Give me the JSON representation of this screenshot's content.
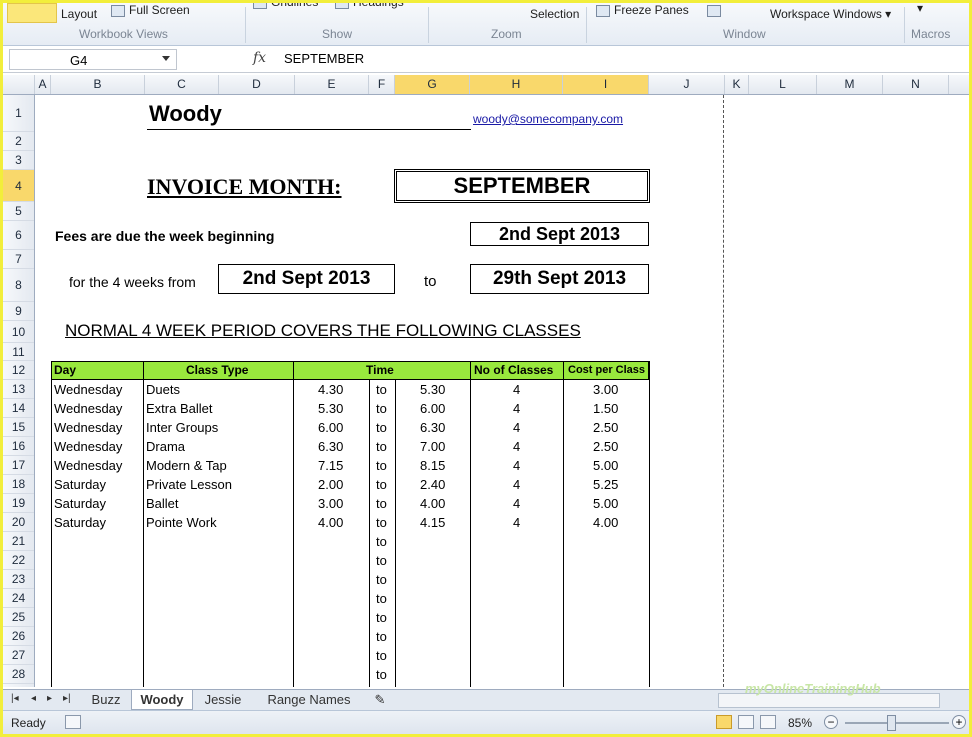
{
  "ribbon": {
    "items": [
      "Layout",
      "Full Screen",
      "Gridlines",
      "Headings",
      "Selection",
      "Freeze Panes",
      "Workspace Windows"
    ],
    "groups": [
      "Workbook Views",
      "Show",
      "Zoom",
      "Window",
      "Macros"
    ]
  },
  "formula_bar": {
    "name_box": "G4",
    "fx": "fx",
    "value": "SEPTEMBER"
  },
  "columns": [
    "A",
    "B",
    "C",
    "D",
    "E",
    "F",
    "G",
    "H",
    "I",
    "J",
    "K",
    "L",
    "M",
    "N"
  ],
  "rows": [
    "1",
    "2",
    "3",
    "4",
    "5",
    "6",
    "7",
    "8",
    "9",
    "10",
    "11",
    "12",
    "13",
    "14",
    "15",
    "16",
    "17",
    "18",
    "19",
    "20",
    "21",
    "22",
    "23",
    "24",
    "25",
    "26",
    "27",
    "28"
  ],
  "sheet": {
    "name": "Woody",
    "email": "woody@somecompany.com",
    "invoice_label": "INVOICE MONTH:",
    "invoice_month": "SEPTEMBER",
    "fees_label": "Fees are due the week beginning",
    "fees_date": "2nd Sept 2013",
    "weeks_label": "for the 4 weeks from",
    "from_date": "2nd Sept 2013",
    "to_label": "to",
    "to_date": "29th Sept 2013",
    "normal_label": "NORMAL 4 WEEK PERIOD COVERS THE FOLLOWING CLASSES",
    "table": {
      "headers": {
        "day": "Day",
        "class_type": "Class Type",
        "time": "Time",
        "no_of_classes": "No of Classes",
        "cost_per_class": "Cost per Class"
      },
      "rows": [
        {
          "day": "Wednesday",
          "class": "Duets",
          "start": "4.30",
          "to": "to",
          "end": "5.30",
          "count": "4",
          "cost": "3.00"
        },
        {
          "day": "Wednesday",
          "class": "Extra Ballet",
          "start": "5.30",
          "to": "to",
          "end": "6.00",
          "count": "4",
          "cost": "1.50"
        },
        {
          "day": "Wednesday",
          "class": "Inter Groups",
          "start": "6.00",
          "to": "to",
          "end": "6.30",
          "count": "4",
          "cost": "2.50"
        },
        {
          "day": "Wednesday",
          "class": "Drama",
          "start": "6.30",
          "to": "to",
          "end": "7.00",
          "count": "4",
          "cost": "2.50"
        },
        {
          "day": "Wednesday",
          "class": "Modern & Tap",
          "start": "7.15",
          "to": "to",
          "end": "8.15",
          "count": "4",
          "cost": "5.00"
        },
        {
          "day": "Saturday",
          "class": "Private Lesson",
          "start": "2.00",
          "to": "to",
          "end": "2.40",
          "count": "4",
          "cost": "5.25"
        },
        {
          "day": "Saturday",
          "class": "Ballet",
          "start": "3.00",
          "to": "to",
          "end": "4.00",
          "count": "4",
          "cost": "5.00"
        },
        {
          "day": "Saturday",
          "class": "Pointe Work",
          "start": "4.00",
          "to": "to",
          "end": "4.15",
          "count": "4",
          "cost": "4.00"
        }
      ],
      "empty_to": [
        "to",
        "to",
        "to",
        "to",
        "to",
        "to",
        "to",
        "to"
      ]
    }
  },
  "tabs": [
    "Buzz",
    "Woody",
    "Jessie",
    "Range Names"
  ],
  "active_tab": "Woody",
  "status": {
    "ready": "Ready",
    "zoom": "85%",
    "minus": "−",
    "plus": "+"
  },
  "watermark": "myOnlineTrainingHub"
}
